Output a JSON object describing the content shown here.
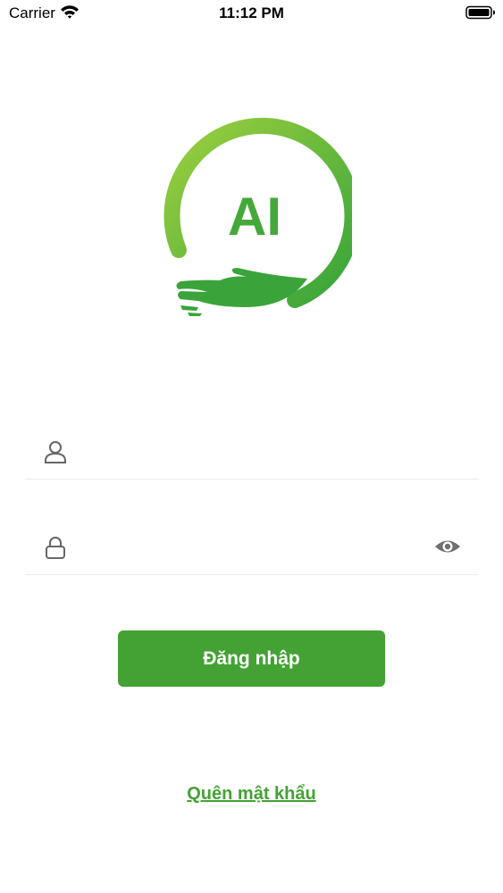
{
  "status_bar": {
    "carrier": "Carrier",
    "time": "11:12 PM",
    "wifi_icon": "wifi-icon",
    "battery_icon": "battery-icon"
  },
  "logo": {
    "text": "AI",
    "colors": {
      "light_green": "#8cc63f",
      "dark_green": "#3aa43a"
    }
  },
  "form": {
    "username": {
      "icon": "user-icon",
      "value": "",
      "placeholder": ""
    },
    "password": {
      "icon": "lock-icon",
      "value": "",
      "placeholder": "",
      "toggle_icon": "eye-icon"
    }
  },
  "login_button": {
    "label": "Đăng nhập",
    "color": "#43a233"
  },
  "forgot_password": {
    "label": "Quên mật khẩu",
    "color": "#43a233"
  }
}
